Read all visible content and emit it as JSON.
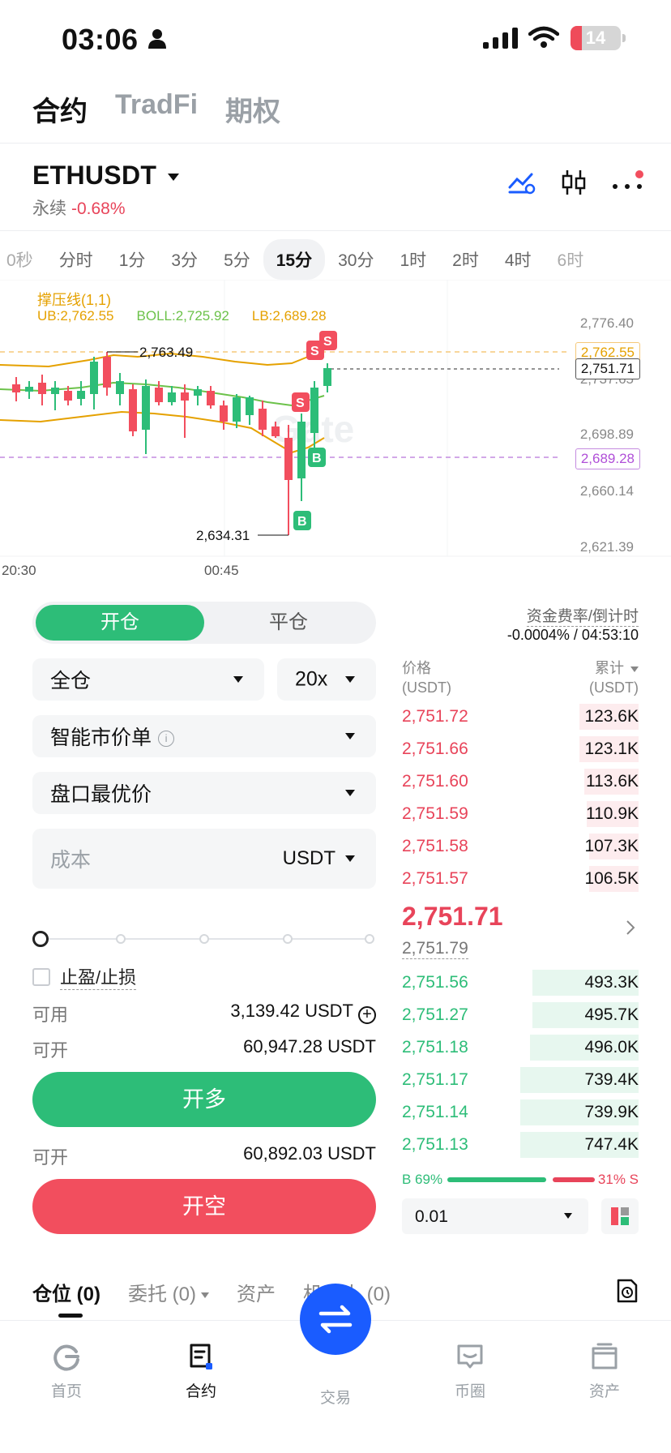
{
  "status_bar": {
    "time": "03:06",
    "battery": "14"
  },
  "top_tabs": [
    "合约",
    "TradFi",
    "期权"
  ],
  "symbol": {
    "name": "ETHUSDT",
    "type": "永续",
    "change": "-0.68%"
  },
  "intervals": [
    "0秒",
    "分时",
    "1分",
    "3分",
    "5分",
    "15分",
    "30分",
    "1时",
    "2时",
    "4时",
    "6时"
  ],
  "chart": {
    "indicator_title": "撑压线(1,1)",
    "ub": "UB:2,762.55",
    "boll": "BOLL:2,725.92",
    "lb": "LB:2,689.28",
    "price_axis": [
      "2,776.40",
      "2,737.65",
      "2,698.89",
      "2,660.14",
      "2,621.39"
    ],
    "tag_ub": "2,762.55",
    "tag_last": "2,751.71",
    "tag_lb": "2,689.28",
    "high_label": "2,763.49",
    "low_label": "2,634.31",
    "time_axis": [
      "20:30",
      "00:45"
    ],
    "marker_sell": "S",
    "marker_buy": "B",
    "colors": {
      "up": "#2dbd78",
      "down": "#f24e5e",
      "ub_line": "#e5a100",
      "mid_line": "#6cc24a",
      "lb_line": "#b04fd8"
    }
  },
  "order_form": {
    "open_label": "开仓",
    "close_label": "平仓",
    "margin_mode": "全仓",
    "leverage": "20x",
    "order_type": "智能市价单",
    "price_type": "盘口最优价",
    "cost_placeholder": "成本",
    "cost_unit": "USDT",
    "tp_sl": "止盈/止损",
    "available_label": "可用",
    "available_value": "3,139.42 USDT",
    "openable_label": "可开",
    "openable_long": "60,947.28 USDT",
    "openable_short": "60,892.03 USDT",
    "long_button": "开多",
    "short_button": "开空"
  },
  "order_book": {
    "funding_title": "资金费率/倒计时",
    "funding_value": "-0.0004% / 04:53:10",
    "price_header": "价格",
    "price_unit": "(USDT)",
    "qty_header": "累计",
    "qty_unit": "(USDT)",
    "asks": [
      {
        "price": "2,751.72",
        "qty": "123.6K",
        "depth": 0.25
      },
      {
        "price": "2,751.66",
        "qty": "123.1K",
        "depth": 0.25
      },
      {
        "price": "2,751.60",
        "qty": "113.6K",
        "depth": 0.23
      },
      {
        "price": "2,751.59",
        "qty": "110.9K",
        "depth": 0.22
      },
      {
        "price": "2,751.58",
        "qty": "107.3K",
        "depth": 0.21
      },
      {
        "price": "2,751.57",
        "qty": "106.5K",
        "depth": 0.21
      }
    ],
    "last_price": "2,751.71",
    "mark_price": "2,751.79",
    "bids": [
      {
        "price": "2,751.56",
        "qty": "493.3K",
        "depth": 0.45
      },
      {
        "price": "2,751.27",
        "qty": "495.7K",
        "depth": 0.45
      },
      {
        "price": "2,751.18",
        "qty": "496.0K",
        "depth": 0.46
      },
      {
        "price": "2,751.17",
        "qty": "739.4K",
        "depth": 0.5
      },
      {
        "price": "2,751.14",
        "qty": "739.9K",
        "depth": 0.5
      },
      {
        "price": "2,751.13",
        "qty": "747.4K",
        "depth": 0.5
      }
    ],
    "buy_ratio": "B 69%",
    "sell_ratio": "31% S",
    "precision": "0.01"
  },
  "position_tabs": [
    "仓位 (0)",
    "委托 (0)",
    "资产",
    "机器人 (0)"
  ],
  "bottom_nav": [
    "首页",
    "合约",
    "交易",
    "币圈",
    "资产"
  ]
}
